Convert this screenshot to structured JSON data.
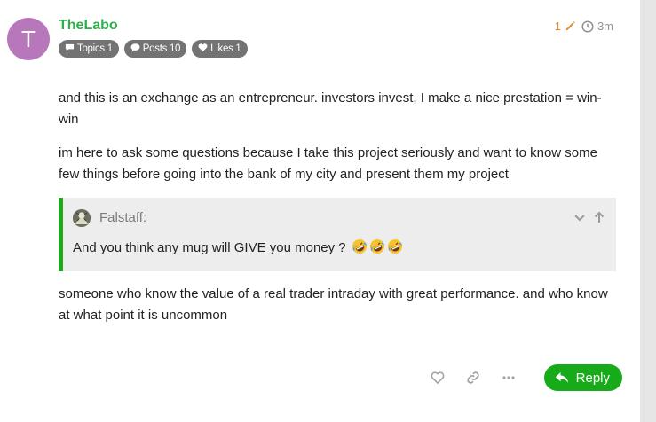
{
  "author": {
    "avatar_letter": "T",
    "avatar_color": "#b877bb",
    "username": "TheLabo",
    "badges": [
      {
        "icon": "topic-icon",
        "label": "Topics 1"
      },
      {
        "icon": "posts-icon",
        "label": "Posts 10"
      },
      {
        "icon": "heart-icon",
        "label": "Likes 1"
      }
    ]
  },
  "meta": {
    "edit_count": "1",
    "edit_icon": "pencil-icon",
    "time_icon": "clock-icon",
    "time": "3m"
  },
  "body": {
    "paragraph_1": "and this is an exchange as an entrepreneur. investors invest, I make a nice prestation = win-win",
    "paragraph_2": "im here to ask some questions because I take this project seriously and want to know some few things before going into the bank of my city and present them my project",
    "quote": {
      "author": "Falstaff:",
      "text": "And you think any mug will GIVE you money ?",
      "emoji": "rolling-on-floor-laughing x3",
      "controls": [
        "chevron-down-icon",
        "arrow-up-icon"
      ]
    },
    "paragraph_3": "someone who know the value of a real trader intraday with great performance. and who know at what point it is uncommon"
  },
  "actions": {
    "icons": [
      "heart-icon",
      "link-icon",
      "more-icon"
    ],
    "reply_label": "Reply"
  },
  "colors": {
    "username": "#2db04c",
    "accent_green": "#17ab1a",
    "edit_orange": "#e8882a",
    "badge_gray": "#737373",
    "quote_bg": "#ededed",
    "quote_border": "#21a81e"
  }
}
